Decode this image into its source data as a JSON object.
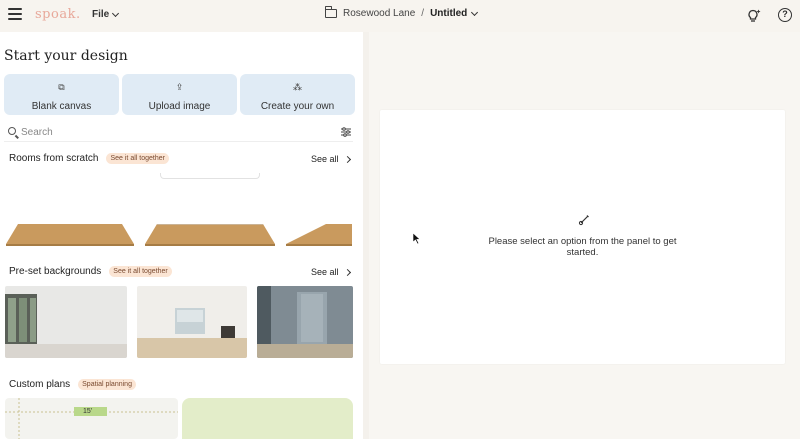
{
  "topbar": {
    "menu_icon": "hamburger-menu-icon",
    "logo": "spoak.",
    "file_label": "File",
    "project_name": "Rosewood Lane",
    "separator": "/",
    "document_name": "Untitled",
    "bulb_icon": "lightbulb-sparkle-icon",
    "help_icon": "help-icon",
    "help_glyph": "?"
  },
  "panel": {
    "title": "Start your design",
    "options": [
      {
        "label": "Blank canvas",
        "icon": "canvas-icon",
        "glyph": "⧉"
      },
      {
        "label": "Upload image",
        "icon": "upload-icon",
        "glyph": "⇪"
      },
      {
        "label": "Create your own",
        "icon": "magic-wand-icon",
        "glyph": "⁂"
      }
    ],
    "search": {
      "placeholder": "Search",
      "value": ""
    },
    "sections": {
      "rooms": {
        "title": "Rooms from scratch",
        "badge": "See it all together",
        "see_all": "See all"
      },
      "backgrounds": {
        "title": "Pre-set backgrounds",
        "badge": "See it all together",
        "see_all": "See all"
      },
      "plans": {
        "title": "Custom plans",
        "badge": "Spatial planning",
        "dimension": "15'"
      }
    }
  },
  "canvas": {
    "hint": "Please select an option from the panel to get started.",
    "hint_icon": "brush-icon"
  },
  "colors": {
    "background": "#f7f4ef",
    "option_tile": "#e0ebf5",
    "badge_bg": "#fbe5d4",
    "logo": "#e8a89a",
    "plan_green": "#e3edc9",
    "wood": "#c99a5e"
  }
}
